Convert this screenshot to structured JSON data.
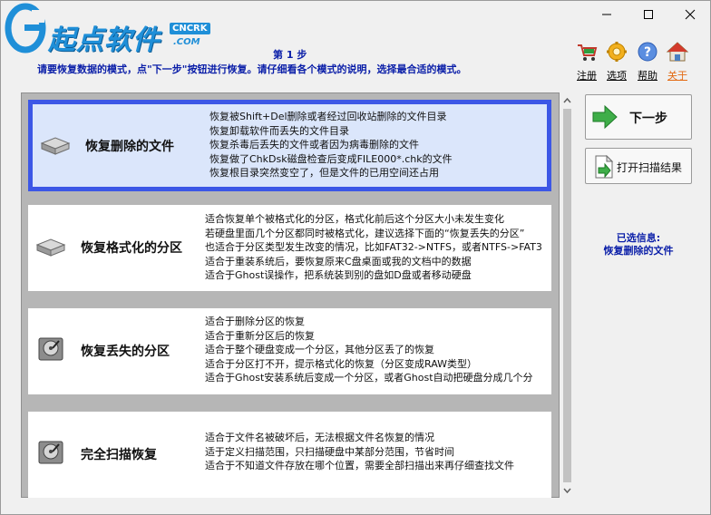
{
  "logo": {
    "text": "起点软件",
    "badge_top": "CNCRK",
    "badge_bottom": ".COM"
  },
  "header": {
    "step": "第 1 步",
    "instruction": "请要恢复数据的模式，点\"下一步\"按钮进行恢复。请仔细看各个模式的说明，选择最合适的模式。"
  },
  "toolbar": {
    "register": "注册",
    "options": "选项",
    "help": "帮助",
    "close": "关于"
  },
  "modes": [
    {
      "name": "恢复删除的文件",
      "icon": "hdd-icon",
      "selected": true,
      "lines": [
        "恢复被Shift+Del删除或者经过回收站删除的文件目录",
        "恢复卸载软件而丢失的文件目录",
        "恢复杀毒后丢失的文件或者因为病毒删除的文件",
        "恢复做了ChkDsk磁盘检查后变成FILE000*.chk的文件",
        "恢复根目录突然变空了，但是文件的已用空间还占用"
      ]
    },
    {
      "name": "恢复格式化的分区",
      "icon": "hdd-icon",
      "selected": false,
      "lines": [
        "适合恢复单个被格式化的分区，格式化前后这个分区大小未发生变化",
        "若硬盘里面几个分区都同时被格式化，建议选择下面的“恢复丢失的分区”",
        "也适合于分区类型发生改变的情况，比如FAT32->NTFS，或者NTFS->FAT3",
        "适合于重装系统后，要恢复原来C盘桌面或我的文档中的数据",
        "适合于Ghost误操作，把系统装到别的盘如D盘或者移动硬盘"
      ]
    },
    {
      "name": "恢复丢失的分区",
      "icon": "hdd-open-icon",
      "selected": false,
      "lines": [
        "适合于删除分区的恢复",
        "适合于重新分区后的恢复",
        "适合于整个硬盘变成一个分区，其他分区丢了的恢复",
        "适合于分区打不开，提示格式化的恢复（分区变成RAW类型）",
        "适合于Ghost安装系统后变成一个分区，或者Ghost自动把硬盘分成几个分"
      ]
    },
    {
      "name": "完全扫描恢复",
      "icon": "hdd-open-icon",
      "selected": false,
      "lines": [
        "适合于文件名被破坏后，无法根据文件名恢复的情况",
        "适于定义扫描范围，只扫描硬盘中某部分范围，节省时间",
        "适合于不知道文件存放在哪个位置，需要全部扫描出来再仔细查找文件"
      ]
    }
  ],
  "buttons": {
    "next": "下一步",
    "open_scan": "打开扫描结果"
  },
  "info": {
    "label": "已选信息:",
    "value": "恢复删除的文件"
  },
  "colors": {
    "accent_blue": "#0a1ea8",
    "selection_border": "#3c57e6",
    "selection_bg": "#dbe6fb",
    "link_orange": "#e36a13"
  }
}
